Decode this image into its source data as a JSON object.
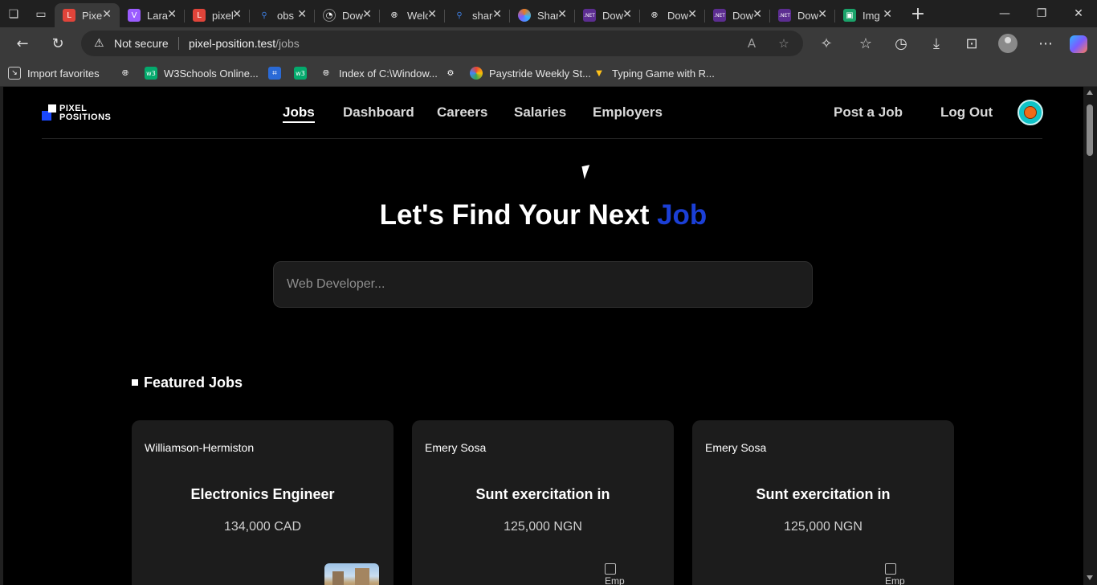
{
  "browser": {
    "tabs": [
      {
        "label": "Pixel Positions",
        "favicon": "laravel-icon",
        "color": "#e0443a",
        "active": true
      },
      {
        "label": "Laravel",
        "favicon": "vite-icon",
        "color": "#9b5cff"
      },
      {
        "label": "pixel-positions",
        "favicon": "laravel-icon",
        "color": "#e0443a"
      },
      {
        "label": "obs",
        "favicon": "search-icon",
        "color": "#3d7de0"
      },
      {
        "label": "Download",
        "favicon": "github-icon",
        "color": "#6a6a6a"
      },
      {
        "label": "Welcome",
        "favicon": "globe-icon",
        "color": "#6a6a6a"
      },
      {
        "label": "share",
        "favicon": "search-icon",
        "color": "#3d7de0"
      },
      {
        "label": "Share",
        "favicon": "colorful-icon",
        "color": "#e67a20"
      },
      {
        "label": "Download .NET",
        "favicon": "dotnet-icon",
        "color": "#5c2d91"
      },
      {
        "label": "Download",
        "favicon": "globe-icon",
        "color": "#6a6a6a"
      },
      {
        "label": "Download .NET",
        "favicon": "dotnet-icon",
        "color": "#5c2d91"
      },
      {
        "label": "Download .NET",
        "favicon": "dotnet-icon",
        "color": "#5c2d91"
      },
      {
        "label": "Img",
        "favicon": "image-icon",
        "color": "#1aa36a"
      }
    ],
    "address": {
      "security_label": "Not secure",
      "host": "pixel-position.test",
      "path": "/jobs"
    },
    "bookmarks": [
      {
        "label": "Import favorites",
        "icon": "import-icon"
      },
      {
        "label": "",
        "icon": "globe-icon"
      },
      {
        "label": "W3Schools Online...",
        "icon": "w3schools-icon"
      },
      {
        "label": "",
        "icon": "app-icon"
      },
      {
        "label": "",
        "icon": "w3schools-icon"
      },
      {
        "label": "Index of C:\\Window...",
        "icon": "globe-icon"
      },
      {
        "label": "",
        "icon": "gear-icon"
      },
      {
        "label": "Paystride Weekly St...",
        "icon": "paystride-icon"
      },
      {
        "label": "Typing Game with R...",
        "icon": "vite-icon"
      }
    ]
  },
  "site": {
    "logo": {
      "line1": "PIXEL",
      "line2": "POSITIONS"
    },
    "nav": [
      "Jobs",
      "Dashboard",
      "Careers",
      "Salaries",
      "Employers"
    ],
    "actions": {
      "post": "Post a Job",
      "logout": "Log Out"
    },
    "hero": {
      "lead": "Let's Find Your Next ",
      "accent": "Job"
    },
    "search": {
      "placeholder": "Web Developer..."
    },
    "featured_title": "Featured Jobs",
    "featured": [
      {
        "company": "Williamson-Hermiston",
        "title": "Electronics Engineer",
        "salary": "134,000 CAD",
        "image": "photo"
      },
      {
        "company": "Emery Sosa",
        "title": "Sunt exercitation in",
        "salary": "125,000 NGN",
        "image": "broken",
        "alt": "Emp"
      },
      {
        "company": "Emery Sosa",
        "title": "Sunt exercitation in",
        "salary": "125,000 NGN",
        "image": "broken",
        "alt": "Emp"
      }
    ]
  },
  "colors": {
    "accent": "#1b3fd6",
    "logo_blue": "#1a48ff",
    "card_bg": "#1c1c1c"
  }
}
